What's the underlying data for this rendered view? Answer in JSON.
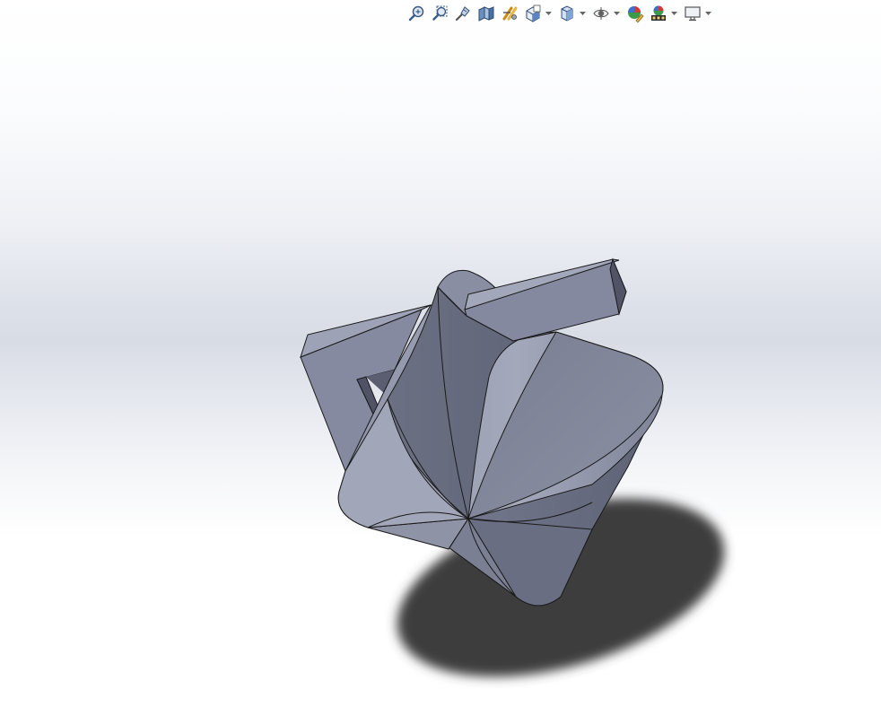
{
  "window": {
    "type": "3D CAD model viewport"
  },
  "heads_up_toolbar": {
    "buttons": [
      {
        "name": "zoom-to-fit",
        "icon": "zoom-to-fit-icon"
      },
      {
        "name": "zoom-to-area",
        "icon": "zoom-to-area-icon"
      },
      {
        "name": "previous-view",
        "icon": "previous-view-icon"
      },
      {
        "name": "section-view",
        "icon": "section-view-icon"
      },
      {
        "name": "dynamic-annotation-views",
        "icon": "dynamic-annotation-icon"
      },
      {
        "name": "view-orientation",
        "icon": "view-orientation-icon",
        "has_dropdown": true
      },
      {
        "name": "display-style",
        "icon": "display-style-icon",
        "has_dropdown": true
      },
      {
        "name": "hide-show-items",
        "icon": "hide-show-items-icon",
        "has_dropdown": true
      },
      {
        "name": "edit-appearance",
        "icon": "edit-appearance-icon"
      },
      {
        "name": "apply-scene",
        "icon": "apply-scene-icon",
        "has_dropdown": true
      },
      {
        "name": "view-settings",
        "icon": "view-settings-icon",
        "has_dropdown": true
      }
    ]
  },
  "model": {
    "color": "#7d8196",
    "edge_color": "#1a1a1a",
    "shadow_color": "#404040"
  }
}
